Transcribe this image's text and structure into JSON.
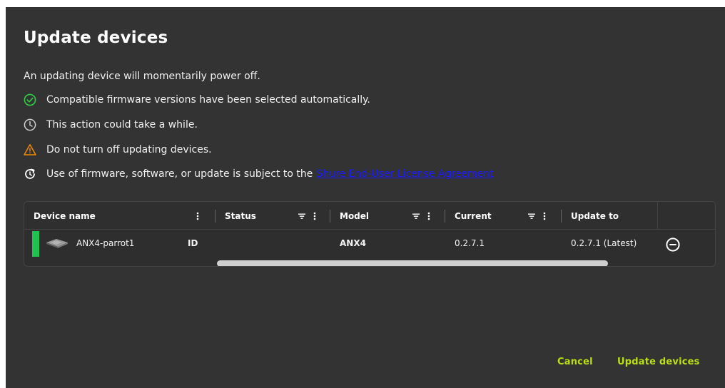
{
  "dialog": {
    "title": "Update devices",
    "intro": "An updating device will momentarily power off.",
    "notes": [
      {
        "icon": "check-circle-icon",
        "color": "#2ecc40",
        "text": "Compatible firmware versions have been selected automatically."
      },
      {
        "icon": "clock-icon",
        "color": "#cfcfcf",
        "text": "This action could take a while."
      },
      {
        "icon": "warning-triangle-icon",
        "color": "#f08a00",
        "text": "Do not turn off updating devices."
      },
      {
        "icon": "refresh-icon",
        "color": "#ffffff",
        "text": "Use of firmware, software, or update is subject to the",
        "link": "Shure End-User License Agreement"
      }
    ]
  },
  "table": {
    "columns": [
      {
        "label": "Device name"
      },
      {
        "label": "Status"
      },
      {
        "label": "Model"
      },
      {
        "label": "Current"
      },
      {
        "label": "Update to"
      }
    ],
    "rows": [
      {
        "status_color": "#21c152",
        "device_name": "ANX4-parrot1",
        "id_label": "ID",
        "status": "",
        "model": "ANX4",
        "current": "0.2.7.1",
        "update_to": "0.2.7.1 (Latest)"
      }
    ]
  },
  "actions": {
    "cancel": "Cancel",
    "update": "Update devices"
  },
  "colors": {
    "dialog_bg": "#333333",
    "accent": "#b8e10f",
    "link": "#1a1aff"
  }
}
